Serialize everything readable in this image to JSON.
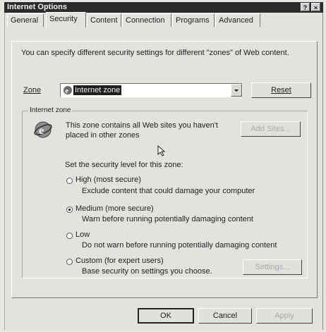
{
  "window": {
    "title": "Internet Options",
    "help_glyph": "?",
    "close_glyph": "×"
  },
  "tabs": [
    {
      "label": "General"
    },
    {
      "label": "Security"
    },
    {
      "label": "Content"
    },
    {
      "label": "Connection"
    },
    {
      "label": "Programs"
    },
    {
      "label": "Advanced"
    }
  ],
  "security": {
    "intro": "You can specify different security settings for different \"zones\" of Web content.",
    "zone_label": "Zone",
    "zone_value": "Internet zone",
    "reset_button": "Reset",
    "group_label": "Internet zone",
    "zone_desc_line1": "This zone contains all Web sites you haven't",
    "zone_desc_line2": "placed in other zones",
    "add_sites_button": "Add Sites...",
    "level_prompt": "Set the security level for this zone:",
    "levels": [
      {
        "label": "High (most secure)",
        "desc": "Exclude content that could damage your computer",
        "selected": false
      },
      {
        "label": "Medium (more secure)",
        "desc": "Warn before running potentially damaging content",
        "selected": true
      },
      {
        "label": "Low",
        "desc": "Do not warn before running potentially damaging content",
        "selected": false
      },
      {
        "label": "Custom (for expert users)",
        "desc": "Base security on settings you choose.",
        "selected": false
      }
    ],
    "settings_button": "Settings..."
  },
  "footer": {
    "ok": "OK",
    "cancel": "Cancel",
    "apply": "Apply"
  }
}
